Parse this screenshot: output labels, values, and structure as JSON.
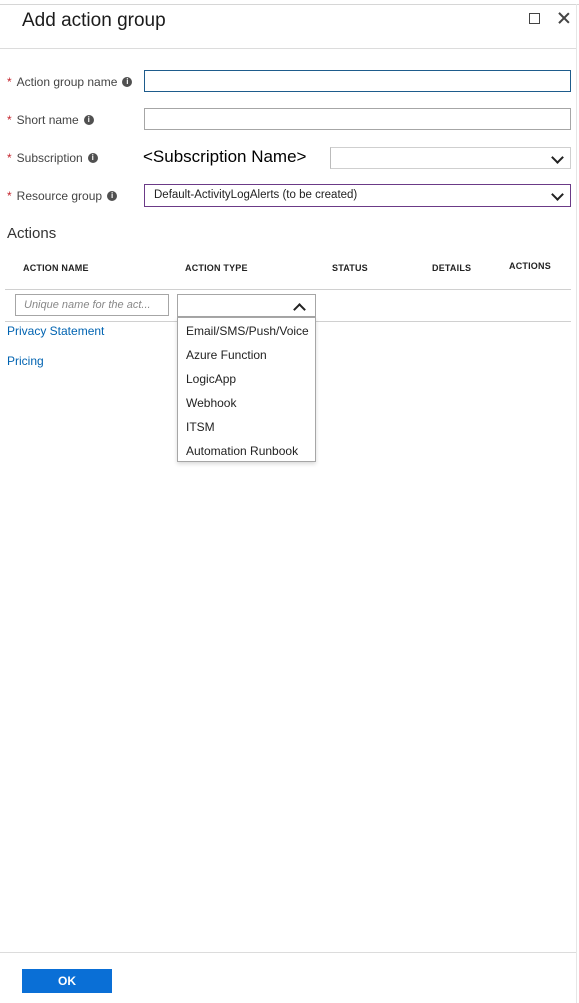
{
  "window": {
    "title": "Add action group"
  },
  "form": {
    "action_group_name": {
      "label": "Action group name",
      "required_mark": "*",
      "value": ""
    },
    "short_name": {
      "label": "Short name",
      "required_mark": "*",
      "value": ""
    },
    "subscription": {
      "label": "Subscription",
      "required_mark": "*",
      "value": "<Subscription Name>"
    },
    "resource_group": {
      "label": "Resource group",
      "required_mark": "*",
      "value": "Default-ActivityLogAlerts (to be created)"
    },
    "info_glyph": "i"
  },
  "actions": {
    "section_title": "Actions",
    "columns": [
      "ACTION NAME",
      "ACTION TYPE",
      "STATUS",
      "DETAILS",
      "ACTIONS"
    ],
    "name_input": {
      "placeholder": "Unique name for the act...",
      "value": ""
    },
    "type_select": {
      "value": ""
    },
    "type_options": [
      "Email/SMS/Push/Voice",
      "Azure Function",
      "LogicApp",
      "Webhook",
      "ITSM",
      "Automation Runbook"
    ]
  },
  "links": {
    "privacy": "Privacy Statement",
    "pricing": "Pricing"
  },
  "footer": {
    "ok_label": "OK"
  },
  "colors": {
    "primary_button": "#0a6fd6",
    "link": "#0063b1",
    "required": "#c4262e",
    "resource_group_border": "#6b3a87"
  }
}
